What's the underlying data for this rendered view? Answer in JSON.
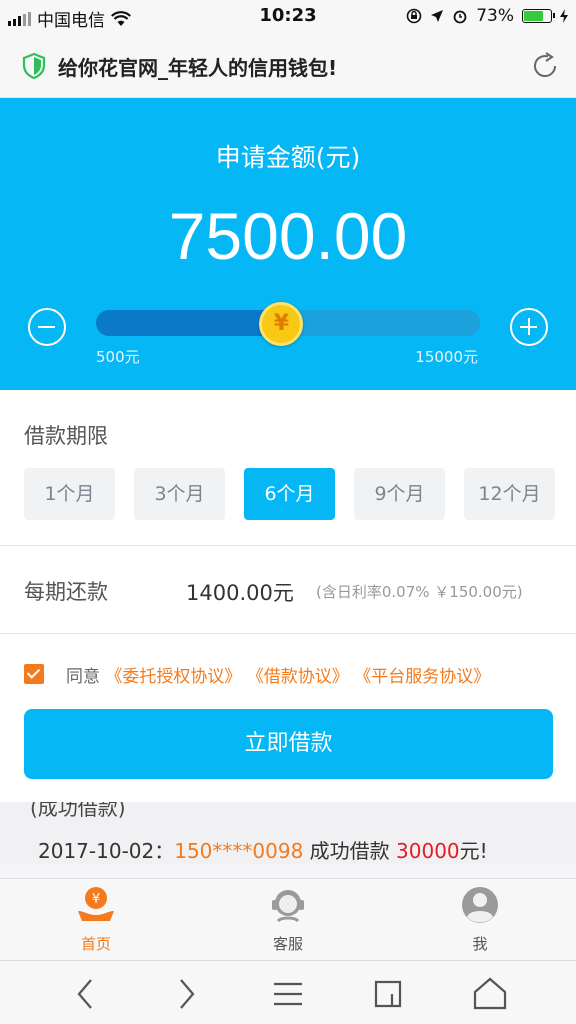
{
  "status_bar": {
    "carrier": "中国电信",
    "time": "10:23",
    "battery": "73%",
    "battery_level": 0.73
  },
  "titlebar": {
    "title": "给你花官网_年轻人的信用钱包!"
  },
  "loan": {
    "amount_label": "申请金额(元)",
    "amount": "7500.00",
    "slider_min": "500元",
    "slider_max": "15000元",
    "slider_value": 7500,
    "slider_range": [
      500,
      15000
    ],
    "coin_symbol": "¥"
  },
  "term": {
    "label": "借款期限",
    "options": [
      "1个月",
      "3个月",
      "6个月",
      "9个月",
      "12个月"
    ],
    "selected": "6个月"
  },
  "repayment": {
    "label": "每期还款",
    "amount": "1400.00元",
    "note": "(含日利率0.07% ￥150.00元)"
  },
  "agreement": {
    "prefix": "同意",
    "links": [
      "《委托授权协议》",
      "《借款协议》",
      "《平台服务协议》"
    ],
    "checked": true
  },
  "submit_label": "立即借款",
  "ticker": {
    "partial_text": "(成功借款)",
    "date": "2017-10-02：",
    "phone": "150****0098",
    "mid": "成功借款",
    "money": "30000",
    "suffix": "元!"
  },
  "tabs": [
    {
      "label": "首页",
      "icon": "home-coin-icon",
      "active": true
    },
    {
      "label": "客服",
      "icon": "customer-service-icon",
      "active": false
    },
    {
      "label": "我",
      "icon": "user-icon",
      "active": false
    }
  ],
  "colors": {
    "primary": "#05b8f5",
    "accent": "#f37b1d",
    "money": "#e51c23"
  }
}
